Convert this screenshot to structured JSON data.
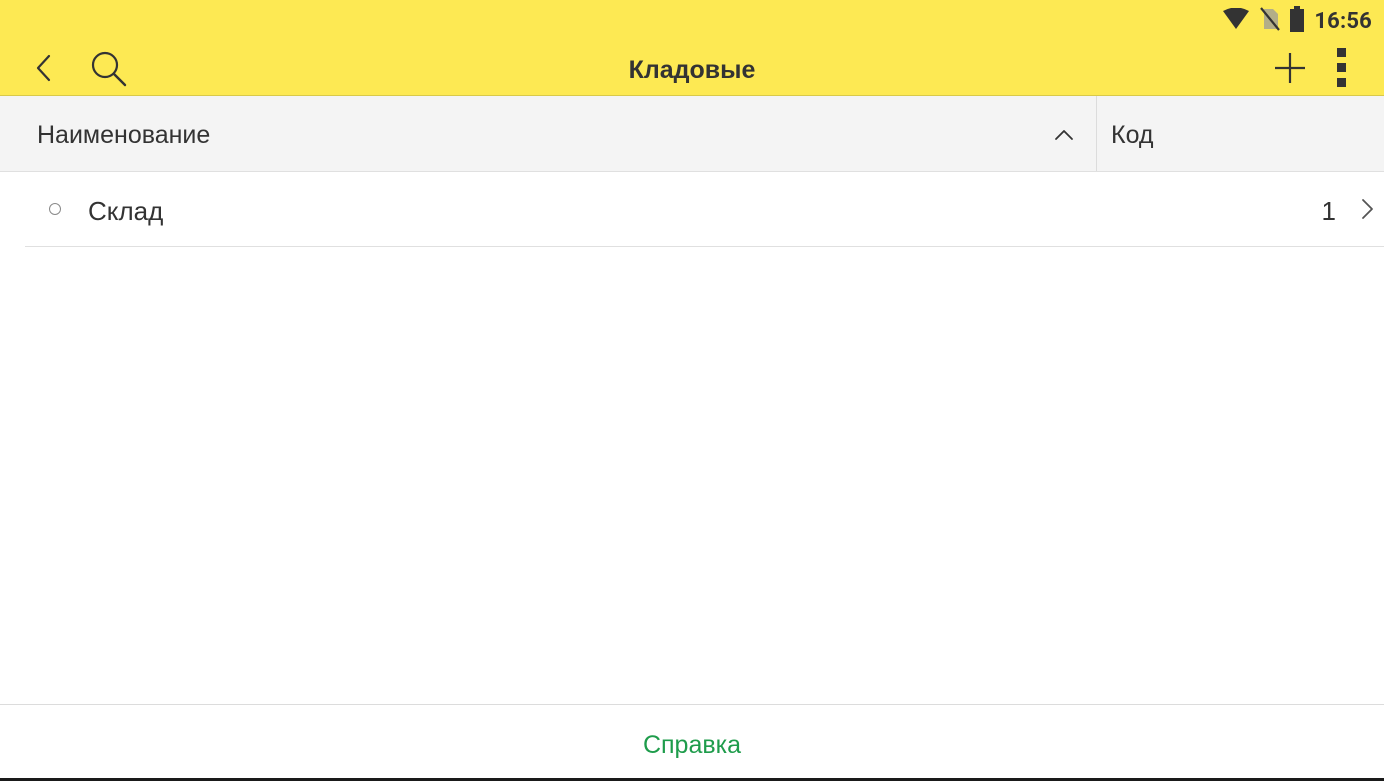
{
  "status_bar": {
    "time": "16:56",
    "icons": [
      "wifi-icon",
      "no-sim-icon",
      "battery-icon"
    ]
  },
  "app_bar": {
    "title": "Кладовые",
    "icons": [
      "back-icon",
      "search-icon",
      "add-icon",
      "more-vert-icon"
    ]
  },
  "table": {
    "columns": [
      {
        "label": "Наименование",
        "sort": "ascending"
      },
      {
        "label": "Код"
      }
    ],
    "rows": [
      {
        "name": "Склад",
        "code": "1"
      }
    ]
  },
  "footer": {
    "help_label": "Справка"
  },
  "colors": {
    "accent": "#fde953",
    "link": "#1e9c4b",
    "text": "#333333"
  }
}
